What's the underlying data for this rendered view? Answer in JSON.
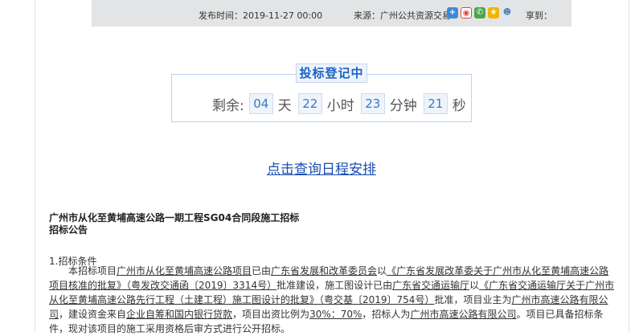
{
  "info_bar": {
    "publish_time": "发布时间：2019-11-27 00:00",
    "source": "来源：广州公共资源交易",
    "share_label": "享到：",
    "share_icons": [
      "plus-icon",
      "weibo-icon",
      "wechat-icon",
      "qzone-icon",
      "person-icon"
    ]
  },
  "countdown": {
    "status": "投标登记中",
    "prefix": "剩余:",
    "days": "04",
    "days_unit": "天",
    "hours": "22",
    "hours_unit": "小时",
    "minutes": "23",
    "minutes_unit": "分钟",
    "seconds": "21",
    "seconds_unit": "秒"
  },
  "schedule_link": "点击查询日程安排",
  "document": {
    "title_line1": "广州市从化至黄埔高速公路一期工程SG04合同段施工招标",
    "title_line2": "招标公告",
    "section1_heading": "1.招标条件",
    "para": {
      "t1": "本招标项目",
      "u1": "广州市从化至黄埔高速公路项目",
      "t2": "已由",
      "u2": "广东省发展和改革委员会",
      "t3": "以",
      "u3": "《广东省发展改革委关于广州市从化至黄埔高速公路项目核准的批复》（粤发改交通函〔2019〕3314号）",
      "t4": "批准建设，施工图设计已由",
      "u4": "广东省交通运输厅",
      "t5": "以",
      "u5": "《广东省交通运输厅关于广州市从化至黄埔高速公路先行工程（土建工程）施工图设计的批复》（粤交基〔2019〕754号）",
      "t6": "批准，项目业主为",
      "u6": "广州市高速公路有限公司",
      "t7": "，建设资金来自",
      "u7": "企业自筹和国内银行贷款",
      "t8": "，项目出资比例为",
      "u8": "30%：70%",
      "t9": "，招标人为",
      "u9": "广州市高速公路有限公司",
      "t10": "。项目已具备招标条件，现对该项目的施工采用资格后审方式进行公开招标。"
    }
  }
}
